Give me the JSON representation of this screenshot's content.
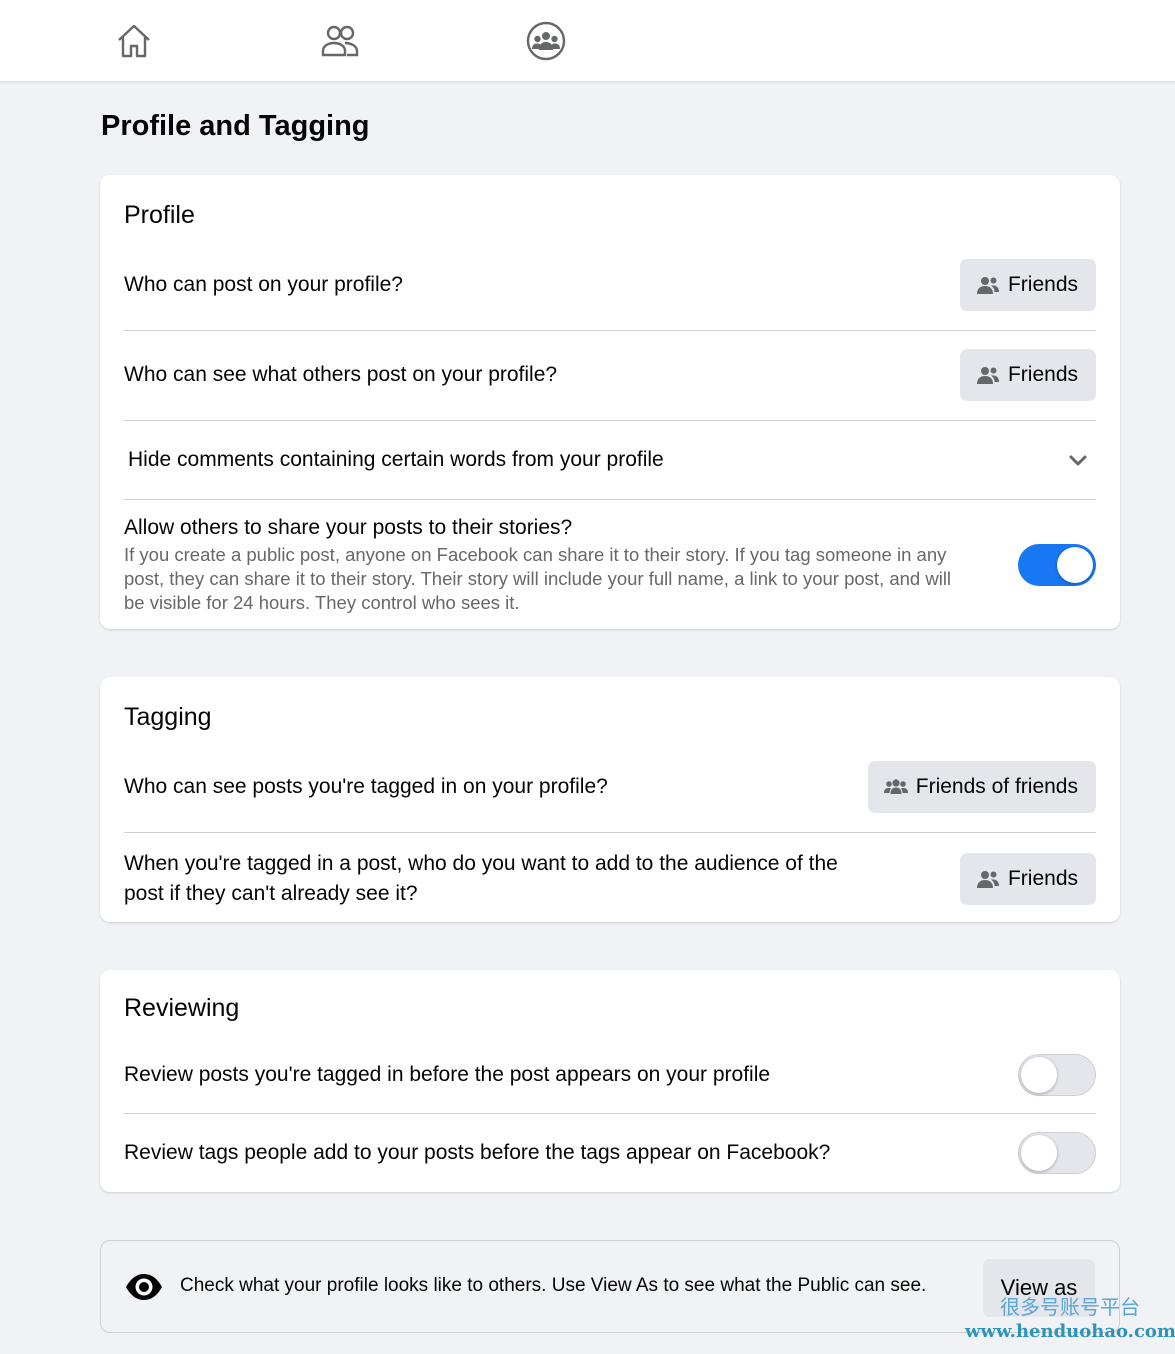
{
  "nav": {
    "home_icon": "home-icon",
    "friends_icon": "friends-icon",
    "groups_icon": "groups-icon"
  },
  "page": {
    "title": "Profile and Tagging"
  },
  "profile": {
    "title": "Profile",
    "who_can_post": {
      "label": "Who can post on your profile?",
      "value": "Friends"
    },
    "who_can_see_others": {
      "label": "Who can see what others post on your profile?",
      "value": "Friends"
    },
    "hide_comments": {
      "label": "Hide comments containing certain words from your profile"
    },
    "share_stories": {
      "label": "Allow others to share your posts to their stories?",
      "description_line1": "If you create a public post, anyone on Facebook can share it to their story. If you tag someone in any",
      "description_line2": "post, they can share it to their story. Their story will include your full name, a link to your post, and will",
      "description_line3": "be visible for 24 hours. They control who sees it.",
      "enabled": true
    }
  },
  "tagging": {
    "title": "Tagging",
    "who_can_see_tagged": {
      "label": "Who can see posts you're tagged in on your profile?",
      "value": "Friends of friends"
    },
    "audience_add": {
      "label_line1": "When you're tagged in a post, who do you want to add to the audience of the",
      "label_line2": "post if they can't already see it?",
      "value": "Friends"
    }
  },
  "reviewing": {
    "title": "Reviewing",
    "review_posts": {
      "label": "Review posts you're tagged in before the post appears on your profile",
      "enabled": false
    },
    "review_tags": {
      "label": "Review tags people add to your posts before the tags appear on Facebook?",
      "enabled": false
    }
  },
  "footer": {
    "text": "Check what your profile looks like to others. Use View As to see what the Public can see.",
    "button": "View as"
  },
  "watermark": {
    "cn": "很多号账号平台",
    "url": "www.henduohao.com"
  },
  "colors": {
    "accent": "#1877f2",
    "background": "#f0f2f5",
    "button_gray": "#e4e6eb",
    "secondary_text": "#65676b"
  }
}
